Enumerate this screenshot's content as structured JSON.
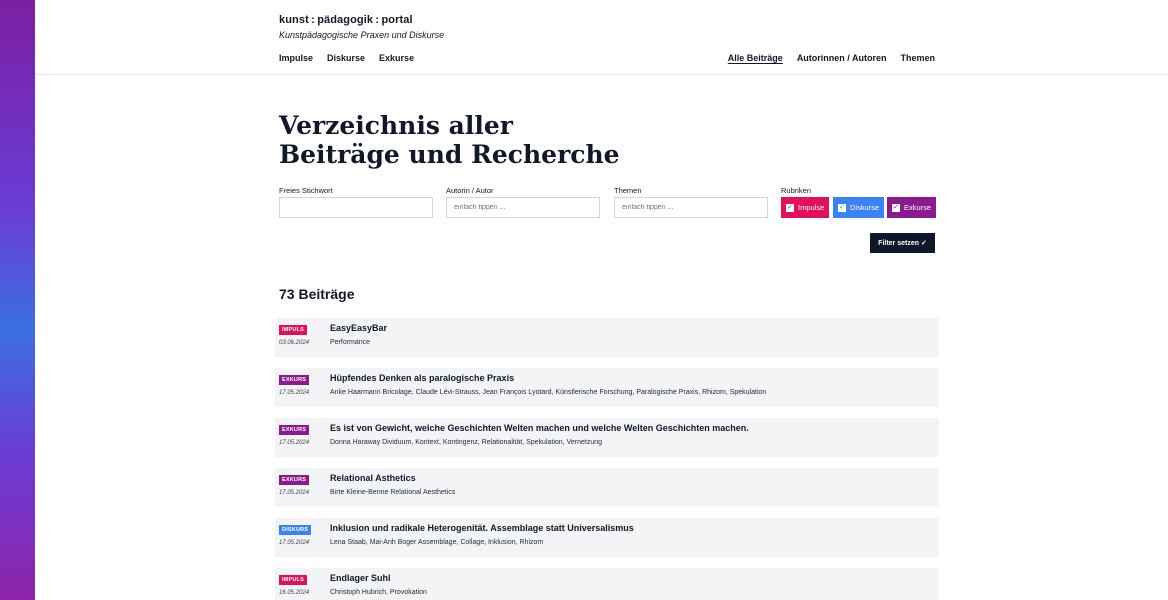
{
  "header": {
    "brand": "kunst : pädagogik : portal",
    "tagline": "Kunstpädagogische Praxen und Diskurse",
    "nav_left": [
      "Impulse",
      "Diskurse",
      "Exkurse"
    ],
    "nav_right": [
      "Alle Beiträge",
      "Autorinnen / Autoren",
      "Themen"
    ],
    "active_nav": "Alle Beiträge"
  },
  "main": {
    "title": "Verzeichnis aller Beiträge und Recherche"
  },
  "filters": {
    "keyword": {
      "label": "Freies Stichwort",
      "value": "",
      "placeholder": ""
    },
    "author": {
      "label": "Autorin / Autor",
      "value": "",
      "placeholder": "einfach tippen ..."
    },
    "themes": {
      "label": "Themen",
      "value": "",
      "placeholder": "einfach tippen ..."
    },
    "rubriken_label": "Rubriken",
    "rubriken": [
      {
        "label": "Impulse",
        "checked": true,
        "color": "#e0105a"
      },
      {
        "label": "Diskurse",
        "checked": true,
        "color": "#3b82f6"
      },
      {
        "label": "Exkurse",
        "checked": true,
        "color": "#8b1a8f"
      }
    ],
    "submit_label": "Filter setzen ✓"
  },
  "results": {
    "count_label": "73 Beiträge",
    "items": [
      {
        "badge": "IMPULS",
        "type": "impuls",
        "date": "03.06.2024",
        "title": "EasyEasyBar",
        "meta": "Performance"
      },
      {
        "badge": "EXKURS",
        "type": "exkurs",
        "date": "17.05.2024",
        "title": "Hüpfendes Denken als paralogische Praxis",
        "meta": "Anke Haarmann Bricolage, Claude Lévi-Strauss, Jean François Lyotard, Künstlerische Forschung, Paralogische Praxis, Rhizom, Spekulation"
      },
      {
        "badge": "EXKURS",
        "type": "exkurs",
        "date": "17.05.2024",
        "title": "Es ist von Gewicht, welche Geschichten Welten machen und welche Welten Geschichten machen.",
        "meta": "Donna Haraway Dividuum, Kontext, Kontingenz, Relationalität, Spekulation, Vernetzung"
      },
      {
        "badge": "EXKURS",
        "type": "exkurs",
        "date": "17.05.2024",
        "title": "Relational Asthetics",
        "meta": "Birte Kleine-Benne Relational Aesthetics"
      },
      {
        "badge": "DISKURS",
        "type": "diskurs",
        "date": "17.05.2024",
        "title": "Inklusion und radikale Heterogenität. Assemblage statt Universalismus",
        "meta": "Lena Staab, Mai-Anh Boger Assemblage, Collage, Inklusion, Rhizom"
      },
      {
        "badge": "IMPULS",
        "type": "impuls",
        "date": "16.05.2024",
        "title": "Endlager Suhl",
        "meta": "Christoph Hubrich, Provokation"
      }
    ]
  },
  "colors": {
    "impuls": "#e0105a",
    "diskurs": "#3b82f6",
    "exkurs": "#8b1a8f",
    "button_dark": "#0f172a",
    "row_bg": "#f3f4f6"
  }
}
